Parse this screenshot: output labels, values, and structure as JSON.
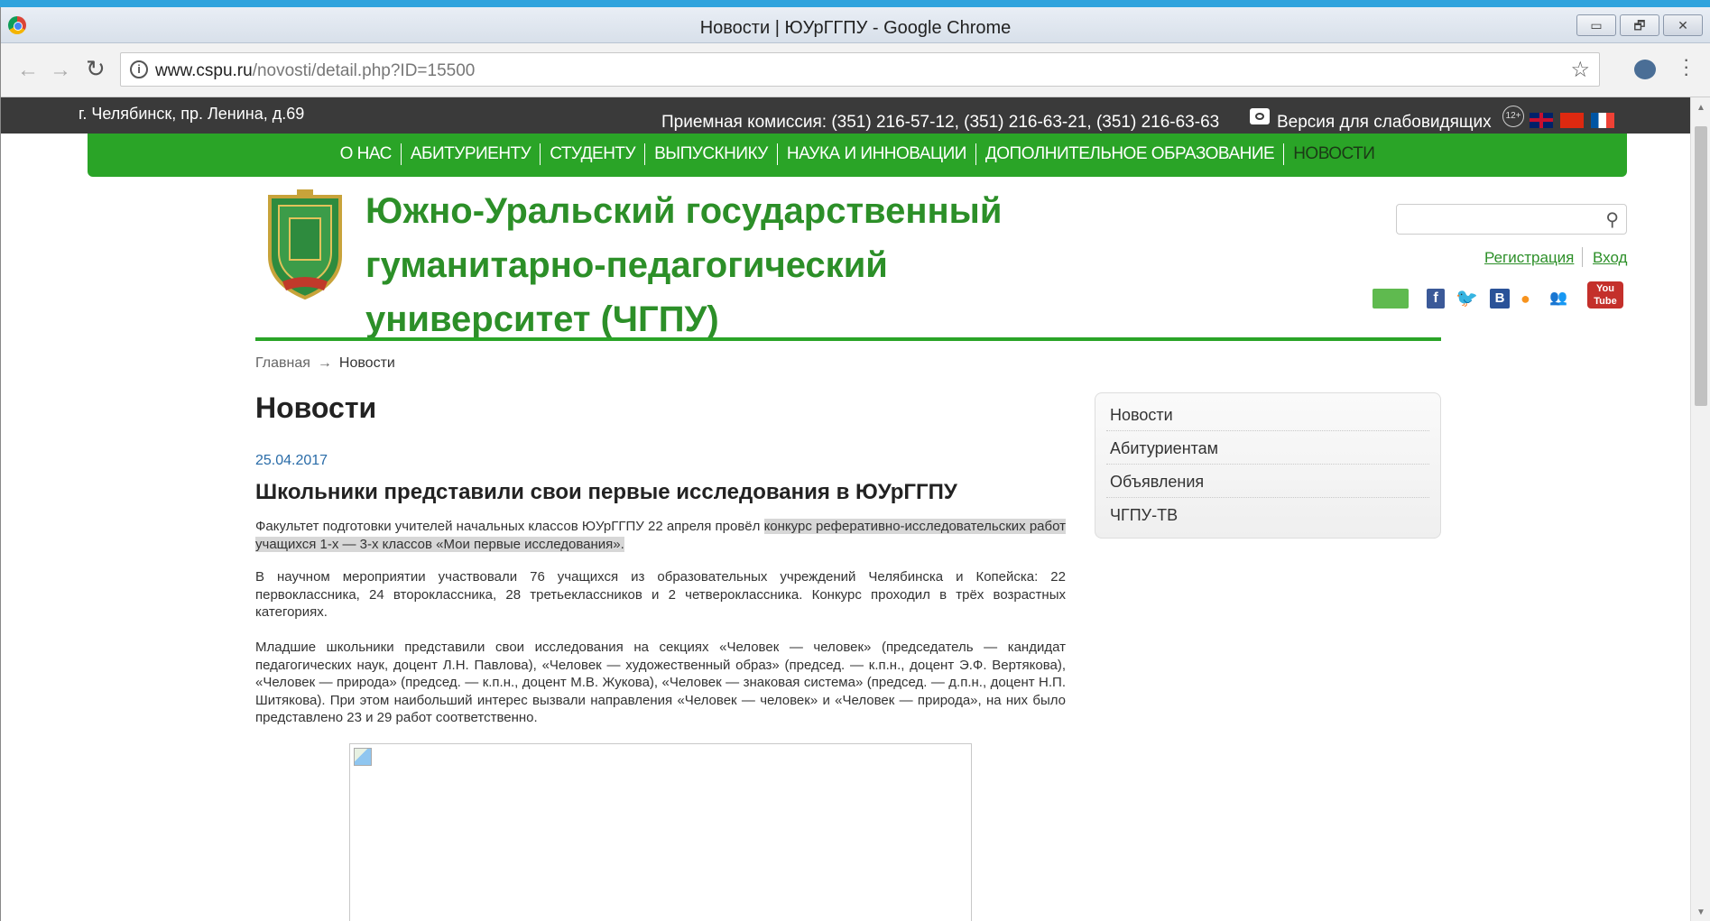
{
  "window": {
    "title": "Новости | ЮУрГГПУ - Google Chrome",
    "buttons": {
      "minimize": "▭",
      "restore": "🗗",
      "close": "✕"
    }
  },
  "browser": {
    "url_host": "www.cspu.ru",
    "url_path": "/novosti/detail.php?ID=15500",
    "icons": [
      "back-icon",
      "forward-icon",
      "reload-icon",
      "info-icon",
      "star-icon",
      "extension-icon",
      "menu-icon"
    ]
  },
  "site": {
    "address": "г. Челябинск, пр. Ленина, д.69",
    "admission": "Приемная комиссия: (351) 216-57-12, (351) 216-63-21, (351) 216-63-63",
    "weak_vision": "Версия для слабовидящих",
    "age_badge": "12+",
    "nav": [
      "О НАС",
      "АБИТУРИЕНТУ",
      "СТУДЕНТУ",
      "ВЫПУСКНИКУ",
      "НАУКА И ИННОВАЦИИ",
      "ДОПОЛНИТЕЛЬНОЕ ОБРАЗОВАНИЕ",
      "НОВОСТИ"
    ],
    "title_lines": [
      "Южно-Уральский государственный",
      "гуманитарно-педагогический",
      "университет (ЧГПУ)"
    ],
    "auth": {
      "register": "Регистрация",
      "login": "Вход"
    },
    "social": {
      "facebook": "f",
      "vk": "В",
      "youtube_top": "You",
      "youtube_bottom": "Tube"
    },
    "colors": {
      "green": "#2aa427",
      "title_green": "#2c8f28",
      "topbar": "#3a3a3a"
    }
  },
  "breadcrumb": {
    "home": "Главная",
    "arrow": "→",
    "current": "Новости"
  },
  "content": {
    "page_title": "Новости",
    "date": "25.04.2017",
    "headline": "Школьники представили свои первые исследования в ЮУрГГПУ",
    "p1_plain": "Факультет подготовки учителей начальных классов ЮУрГГПУ 22 апреля провёл ",
    "p1_highlight": "конкурс реферативно-исследовательских работ учащихся 1-х — 3-х классов «Мои первые исследования».",
    "p2": "В научном мероприятии участвовали 76 учащихся из образовательных учреждений Челябинска и Копейска: 22 первоклассника, 24 второклассника, 28 третьеклассников и 2 четвероклассника. Конкурс проходил в трёх возрастных категориях.",
    "p3": "Младшие школьники представили свои исследования на секциях «Человек — человек» (председатель — кандидат педагогических наук, доцент Л.Н. Павлова), «Человек — художественный образ» (председ. — к.п.н., доцент Э.Ф. Вертякова), «Человек — природа» (председ. — к.п.н., доцент М.В. Жукова), «Человек — знаковая система» (председ. — д.п.н., доцент Н.П. Шитякова). При этом наибольший интерес вызвали направления «Человек — человек» и «Человек — природа», на них было представлено 23 и 29 работ соответственно."
  },
  "sidebar": {
    "items": [
      "Новости",
      "Абитуриентам",
      "Объявления",
      "ЧГПУ-ТВ"
    ]
  }
}
